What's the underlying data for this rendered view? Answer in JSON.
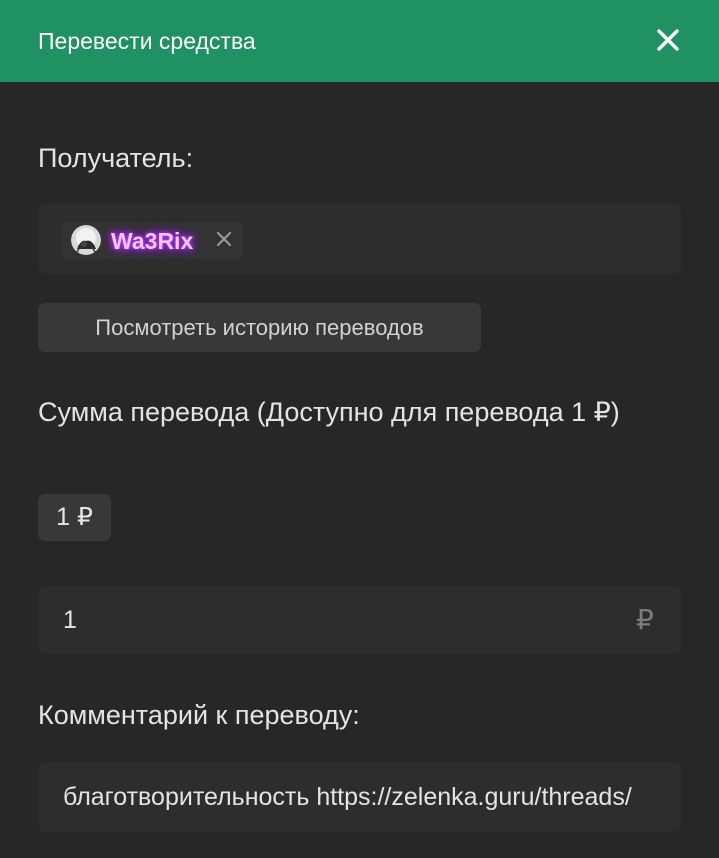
{
  "dialog": {
    "title": "Перевести средства",
    "close_icon": "close-icon"
  },
  "recipient": {
    "label": "Получатель:",
    "chip": {
      "avatar_icon": "avatar",
      "name": "Wa3Rix",
      "name_color": "#f0c8ff",
      "remove_icon": "remove-x-icon"
    },
    "history_button": "Посмотреть историю переводов"
  },
  "amount": {
    "label": "Сумма перевода (Доступно для перевода 1 ₽)",
    "quick_amount": "1 ₽",
    "value": "1",
    "currency": "₽"
  },
  "comment": {
    "label": "Комментарий к переводу:",
    "value": "благотворительность https://zelenka.guru/threads/"
  },
  "colors": {
    "header": "#1f9163",
    "background": "#272727",
    "input": "#2d2d2d",
    "button": "#383838"
  }
}
